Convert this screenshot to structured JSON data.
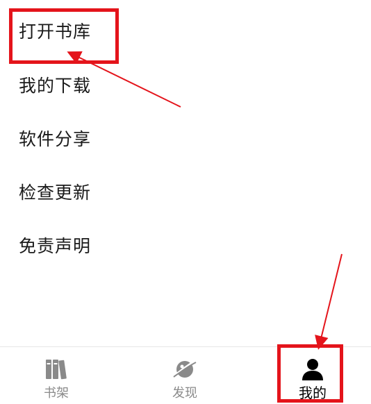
{
  "menu": {
    "items": [
      {
        "label": "打开书库"
      },
      {
        "label": "我的下载"
      },
      {
        "label": "软件分享"
      },
      {
        "label": "检查更新"
      },
      {
        "label": "免责声明"
      }
    ]
  },
  "tabbar": {
    "tabs": [
      {
        "label": "书架",
        "icon": "bookshelf-icon",
        "active": false
      },
      {
        "label": "发现",
        "icon": "planet-icon",
        "active": false
      },
      {
        "label": "我的",
        "icon": "user-icon",
        "active": true
      }
    ]
  },
  "annotations": {
    "highlight_color": "#e4141b",
    "arrow_color": "#e4141b"
  }
}
